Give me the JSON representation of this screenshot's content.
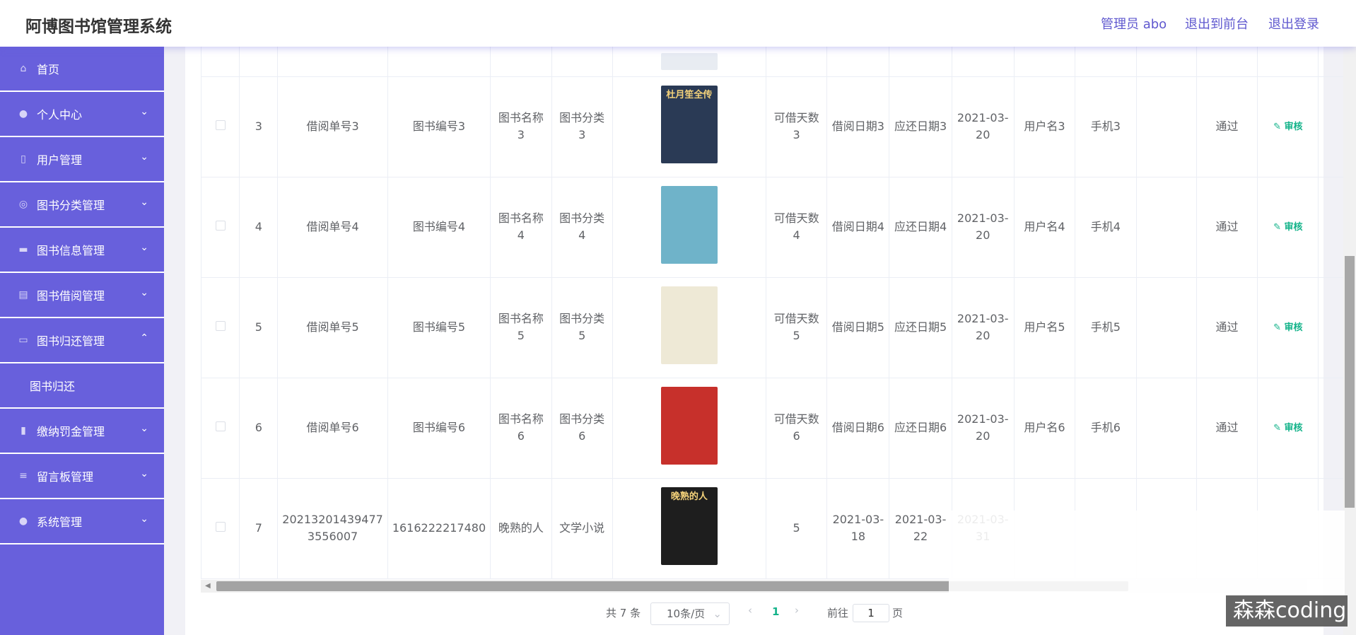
{
  "header": {
    "brand": "阿博图书馆管理系统",
    "admin": "管理员 abo",
    "to_front": "退出到前台",
    "logout": "退出登录"
  },
  "sidebar": {
    "items": [
      {
        "label": "首页",
        "icon": "home-icon",
        "expandable": false
      },
      {
        "label": "个人中心",
        "icon": "user-icon",
        "expandable": true
      },
      {
        "label": "用户管理",
        "icon": "phone-icon",
        "expandable": true
      },
      {
        "label": "图书分类管理",
        "icon": "globe-icon",
        "expandable": true
      },
      {
        "label": "图书信息管理",
        "icon": "briefcase-icon",
        "expandable": true
      },
      {
        "label": "图书借阅管理",
        "icon": "clipboard-icon",
        "expandable": true
      },
      {
        "label": "图书归还管理",
        "icon": "monitor-icon",
        "expandable": true,
        "expanded": true,
        "sub": "图书归还"
      },
      {
        "label": "缴纳罚金管理",
        "icon": "bar-chart-icon",
        "expandable": true
      },
      {
        "label": "留言板管理",
        "icon": "list-icon",
        "expandable": true
      },
      {
        "label": "系统管理",
        "icon": "palette-icon",
        "expandable": true
      }
    ]
  },
  "table": {
    "rows": [
      {
        "no": "3",
        "borrow_no": "借阅单号3",
        "book_no": "图书编号3",
        "book_name": "图书名称3",
        "category": "图书分类3",
        "cover_text": "杜月笙全传",
        "cover_color": "#2a3a55",
        "days": "可借天数3",
        "borrow_date": "借阅日期3",
        "due_date": "应还日期3",
        "return_date": "2021-03-20",
        "username": "用户名3",
        "phone": "手机3",
        "status": "通过",
        "action": "审核"
      },
      {
        "no": "4",
        "borrow_no": "借阅单号4",
        "book_no": "图书编号4",
        "book_name": "图书名称4",
        "category": "图书分类4",
        "cover_text": "",
        "cover_color": "#6fb3c9",
        "days": "可借天数4",
        "borrow_date": "借阅日期4",
        "due_date": "应还日期4",
        "return_date": "2021-03-20",
        "username": "用户名4",
        "phone": "手机4",
        "status": "通过",
        "action": "审核"
      },
      {
        "no": "5",
        "borrow_no": "借阅单号5",
        "book_no": "图书编号5",
        "book_name": "图书名称5",
        "category": "图书分类5",
        "cover_text": "",
        "cover_color": "#eee9d6",
        "days": "可借天数5",
        "borrow_date": "借阅日期5",
        "due_date": "应还日期5",
        "return_date": "2021-03-20",
        "username": "用户名5",
        "phone": "手机5",
        "status": "通过",
        "action": "审核"
      },
      {
        "no": "6",
        "borrow_no": "借阅单号6",
        "book_no": "图书编号6",
        "book_name": "图书名称6",
        "category": "图书分类6",
        "cover_text": "",
        "cover_color": "#c7302b",
        "days": "可借天数6",
        "borrow_date": "借阅日期6",
        "due_date": "应还日期6",
        "return_date": "2021-03-20",
        "username": "用户名6",
        "phone": "手机6",
        "status": "通过",
        "action": "审核"
      },
      {
        "no": "7",
        "borrow_no": "20213201439477 3556007",
        "book_no": "1616222217480",
        "book_name": "晚熟的人",
        "category": "文学小说",
        "cover_text": "晚熟的人",
        "cover_color": "#1e1e1e",
        "days": "5",
        "borrow_date": "2021-03-18",
        "due_date": "2021-03-22",
        "return_date": "2021-03-31",
        "username": "",
        "phone": "",
        "status": "",
        "action": ""
      }
    ]
  },
  "pagination": {
    "total": "共 7 条",
    "page_size": "10条/页",
    "current": "1",
    "goto_prefix": "前往",
    "goto_value": "1",
    "goto_suffix": "页"
  },
  "watermark": "森森coding"
}
